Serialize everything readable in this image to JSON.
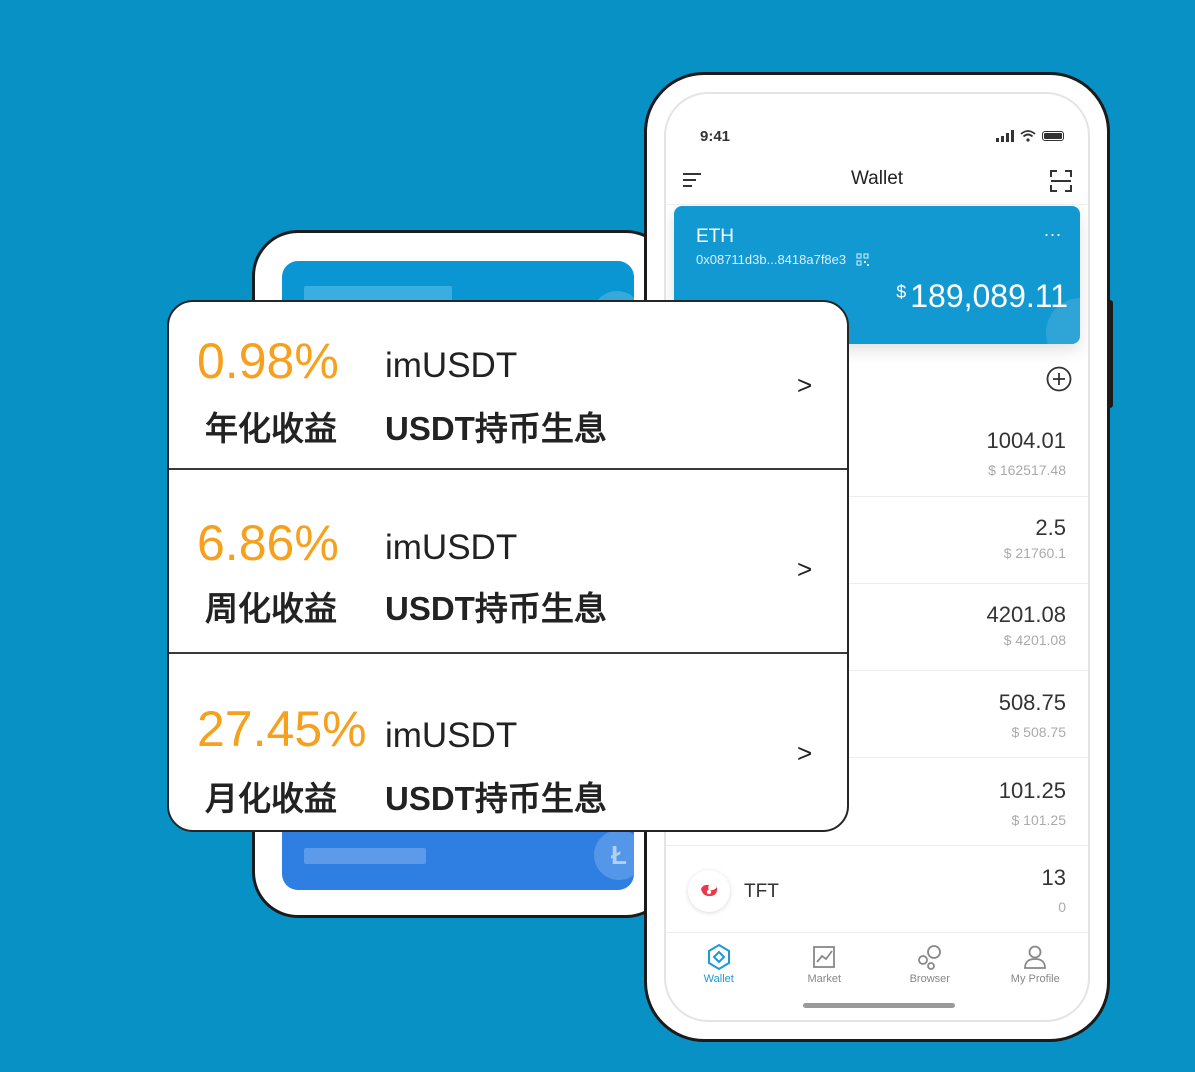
{
  "back_phone": {
    "coin_glyph": "Ł"
  },
  "phone": {
    "status": {
      "time": "9:41"
    },
    "nav": {
      "title": "Wallet"
    },
    "eth_card": {
      "name": "ETH",
      "address": "0x08711d3b...8418a7f8e3",
      "more": "...",
      "currency": "$",
      "balance": "189,089.11"
    },
    "assets": [
      {
        "amount": "1004.01",
        "usd": "$ 162517.48"
      },
      {
        "amount": "2.5",
        "usd": "$ 21760.1"
      },
      {
        "amount": "4201.08",
        "usd": "$ 4201.08"
      },
      {
        "amount": "508.75",
        "usd": "$ 508.75"
      },
      {
        "amount": "101.25",
        "usd": "$ 101.25"
      },
      {
        "name": "TFT",
        "amount": "13",
        "usd": "0"
      }
    ],
    "tabs": [
      {
        "label": "Wallet",
        "icon": "wallet-icon",
        "active": true
      },
      {
        "label": "Market",
        "icon": "market-chart-icon",
        "active": false
      },
      {
        "label": "Browser",
        "icon": "browser-bubbles-icon",
        "active": false
      },
      {
        "label": "My Profile",
        "icon": "profile-icon",
        "active": false
      }
    ],
    "accent": "#1399d2"
  },
  "overlay": {
    "items": [
      {
        "rate": "0.98%",
        "period": "年化收益",
        "product": "imUSDT",
        "description": "USDT持币生息",
        "chevron": ">"
      },
      {
        "rate": "6.86%",
        "period": "周化收益",
        "product": "imUSDT",
        "description": "USDT持币生息",
        "chevron": ">"
      },
      {
        "rate": "27.45%",
        "period": "月化收益",
        "product": "imUSDT",
        "description": "USDT持币生息",
        "chevron": ">"
      }
    ],
    "rate_color": "#f6a01d"
  },
  "background_color": "#0891c4"
}
